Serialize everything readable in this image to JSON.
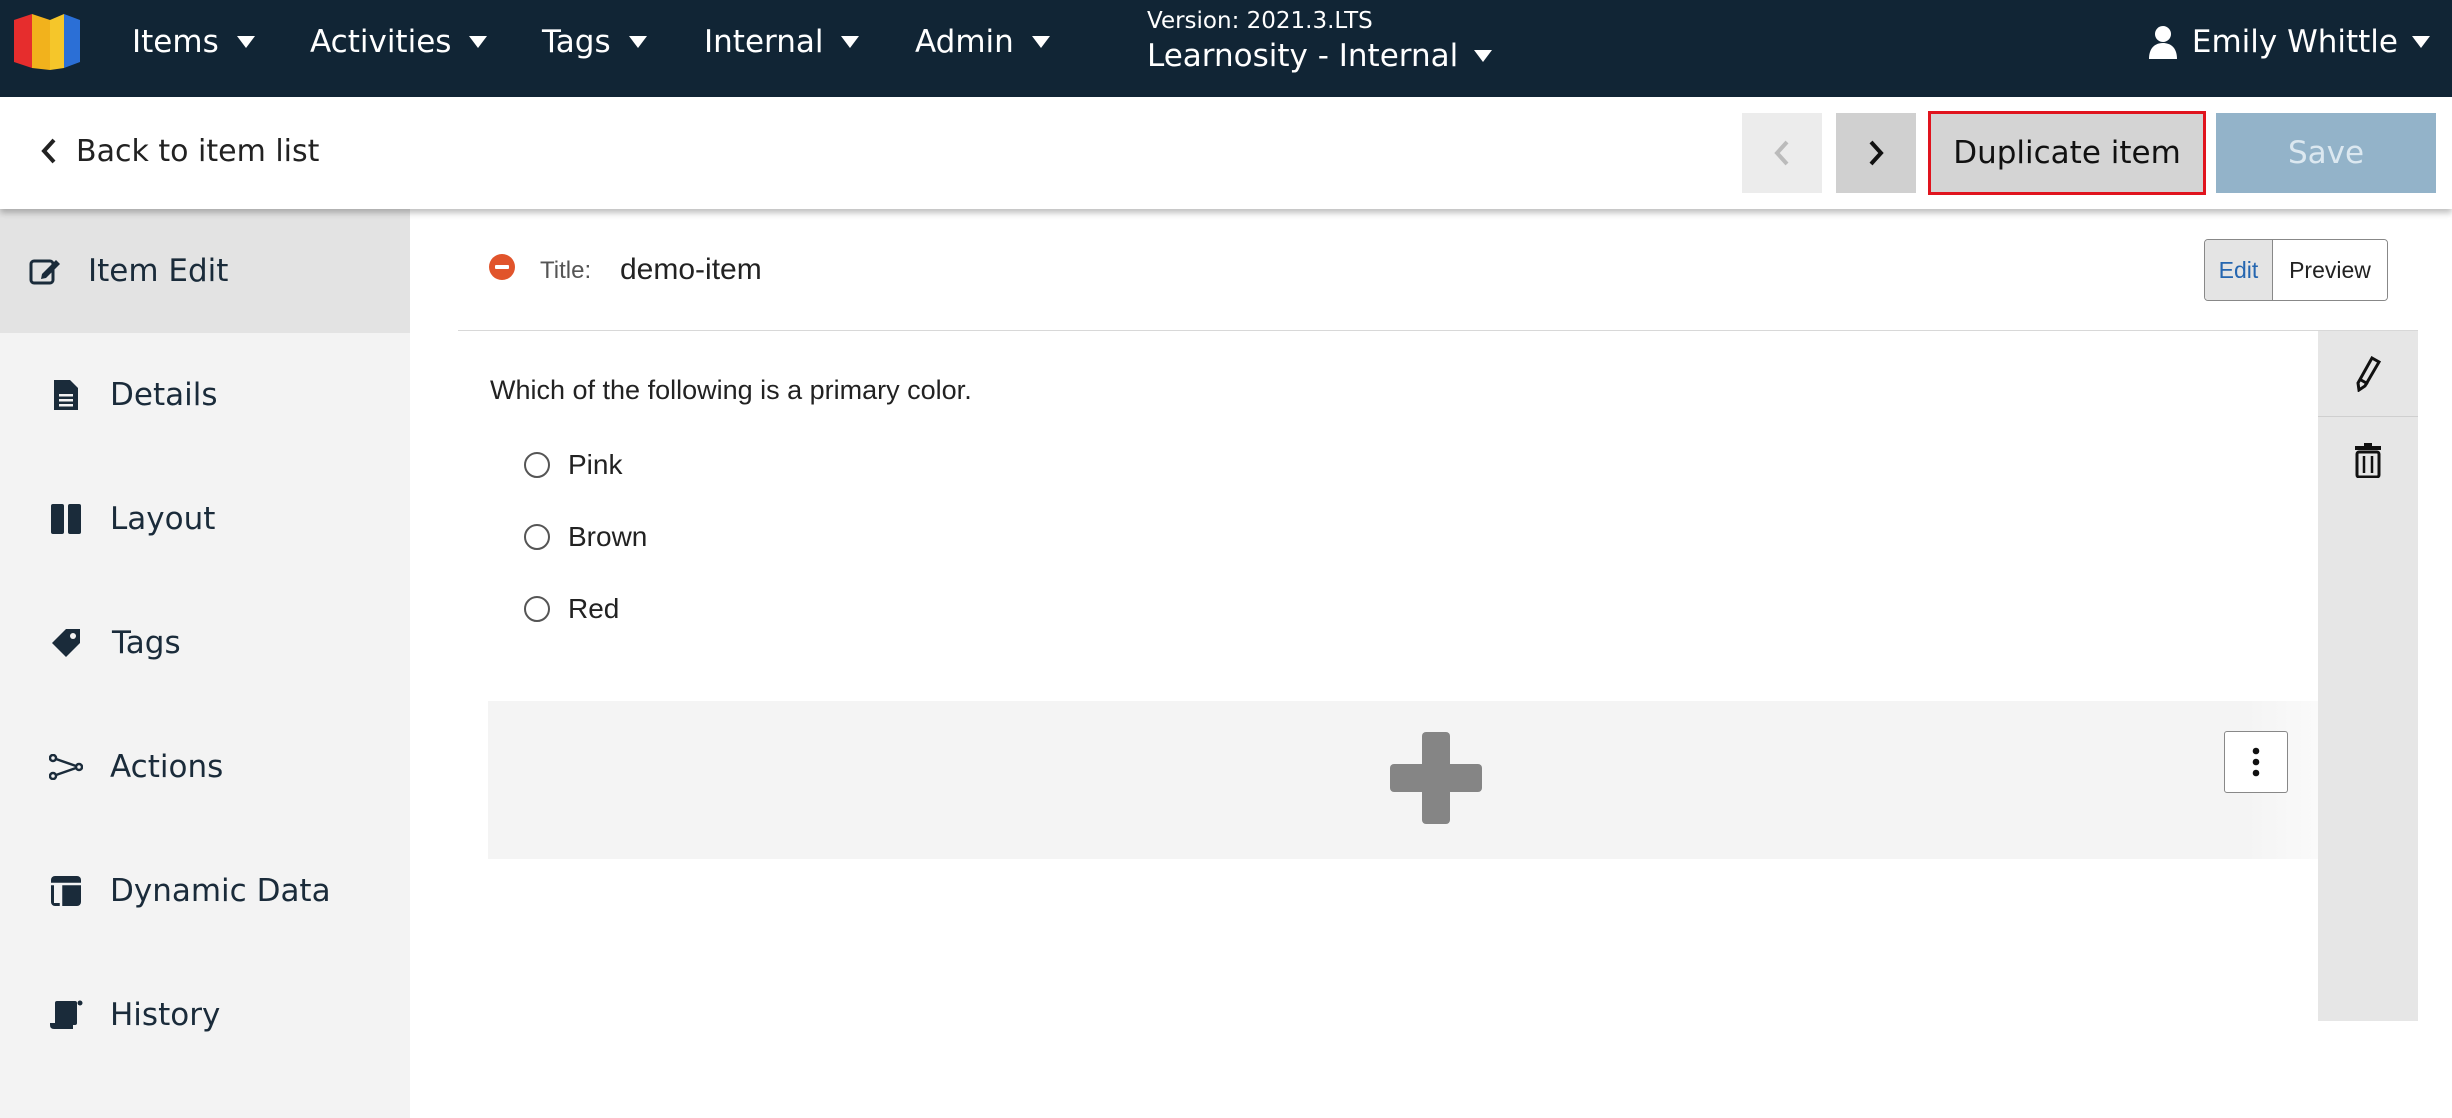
{
  "colors": {
    "nav_bg": "#112535",
    "duplicate_outline": "#e0141e",
    "save_disabled": "#93b3c9",
    "remove_icon": "#e1542b",
    "edit_active": "#2566b0"
  },
  "topnav": {
    "logo_icon": "learnosity-logo-icon",
    "menus": [
      {
        "label": "Items"
      },
      {
        "label": "Activities"
      },
      {
        "label": "Tags"
      },
      {
        "label": "Internal"
      },
      {
        "label": "Admin"
      }
    ],
    "version": "Version: 2021.3.LTS",
    "organisation": "Learnosity - Internal",
    "user": "Emily Whittle",
    "user_icon": "user-icon"
  },
  "toolbar": {
    "back_label": "Back to item list",
    "duplicate_label": "Duplicate item",
    "save_label": "Save"
  },
  "sidebar": {
    "items": [
      {
        "label": "Item Edit",
        "icon": "edit-icon",
        "active": true
      },
      {
        "label": "Details",
        "icon": "document-icon"
      },
      {
        "label": "Layout",
        "icon": "columns-icon"
      },
      {
        "label": "Tags",
        "icon": "tag-icon"
      },
      {
        "label": "Actions",
        "icon": "share-icon"
      },
      {
        "label": "Dynamic Data",
        "icon": "table-icon"
      },
      {
        "label": "History",
        "icon": "scroll-icon"
      }
    ]
  },
  "item": {
    "title_label": "Title:",
    "title_value": "demo-item",
    "mode": {
      "edit": "Edit",
      "preview": "Preview"
    },
    "question": "Which of the following is a primary color.",
    "options": [
      {
        "label": "Pink"
      },
      {
        "label": "Brown"
      },
      {
        "label": "Red"
      }
    ]
  }
}
